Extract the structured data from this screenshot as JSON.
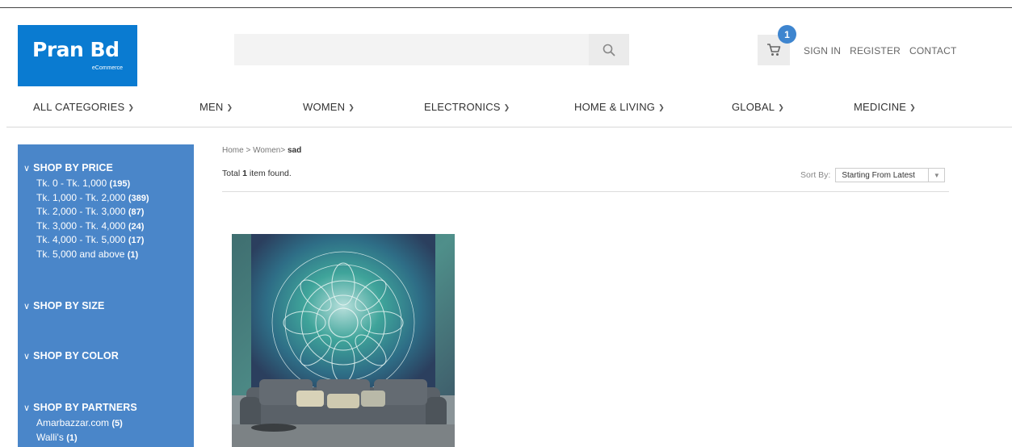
{
  "logo": {
    "main": "Pran Bd",
    "sub": "eCommerce"
  },
  "search": {
    "placeholder": ""
  },
  "cart": {
    "count": "1"
  },
  "top_links": [
    "SIGN IN",
    "REGISTER",
    "CONTACT"
  ],
  "nav": [
    "ALL CATEGORIES",
    "MEN",
    "WOMEN",
    "ELECTRONICS",
    "HOME & LIVING",
    "GLOBAL",
    "MEDICINE"
  ],
  "sidebar": {
    "price": {
      "title": "SHOP BY PRICE",
      "items": [
        {
          "label": "Tk. 0 - Tk. 1,000",
          "count": "(195)"
        },
        {
          "label": "Tk. 1,000 - Tk. 2,000",
          "count": "(389)"
        },
        {
          "label": "Tk. 2,000 - Tk. 3,000",
          "count": "(87)"
        },
        {
          "label": "Tk. 3,000 - Tk. 4,000",
          "count": "(24)"
        },
        {
          "label": "Tk. 4,000 - Tk. 5,000",
          "count": "(17)"
        },
        {
          "label": "Tk. 5,000 and above",
          "count": "(1)"
        }
      ]
    },
    "size": {
      "title": "SHOP BY SIZE"
    },
    "color": {
      "title": "SHOP BY COLOR"
    },
    "partners": {
      "title": "SHOP BY PARTNERS",
      "items": [
        {
          "label": "Amarbazzar.com",
          "count": "(5)"
        },
        {
          "label": "Walli's",
          "count": "(1)"
        }
      ]
    }
  },
  "breadcrumb": {
    "home": "Home",
    "sep1": " > ",
    "cat": "Women",
    "sep2": "> ",
    "current": "sad"
  },
  "results": {
    "prefix": "Total ",
    "count": "1",
    "suffix": " item found."
  },
  "sort": {
    "label": "Sort By:",
    "value": "Starting From Latest"
  },
  "colors": {
    "brand": "#0a7bd1",
    "sidebar": "#4a86c9",
    "badge": "#3e85cf"
  }
}
